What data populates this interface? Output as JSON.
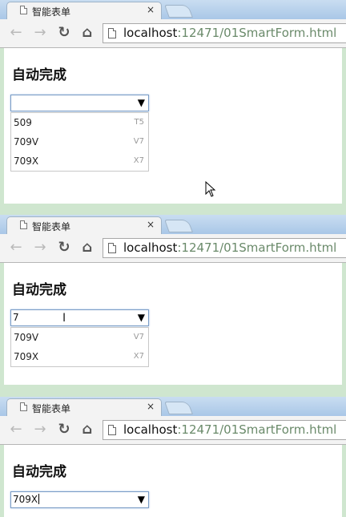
{
  "browser": {
    "tab_title": "智能表单",
    "close_glyph": "×",
    "url_host": "localhost",
    "url_rest": ":12471/01SmartForm.html"
  },
  "page": {
    "heading": "自动完成"
  },
  "panels": [
    {
      "input_value": "",
      "options": [
        {
          "name": "509",
          "code": "T5"
        },
        {
          "name": "709V",
          "code": "V7"
        },
        {
          "name": "709X",
          "code": "X7"
        }
      ]
    },
    {
      "input_value": "7",
      "options": [
        {
          "name": "709V",
          "code": "V7"
        },
        {
          "name": "709X",
          "code": "X7"
        }
      ]
    },
    {
      "input_value": "709X",
      "options": []
    }
  ],
  "icons": {
    "back": "back-arrow-icon",
    "forward": "forward-arrow-icon",
    "reload": "reload-icon",
    "home": "home-icon",
    "page": "page-icon",
    "dropdown": "dropdown-arrow-icon"
  }
}
